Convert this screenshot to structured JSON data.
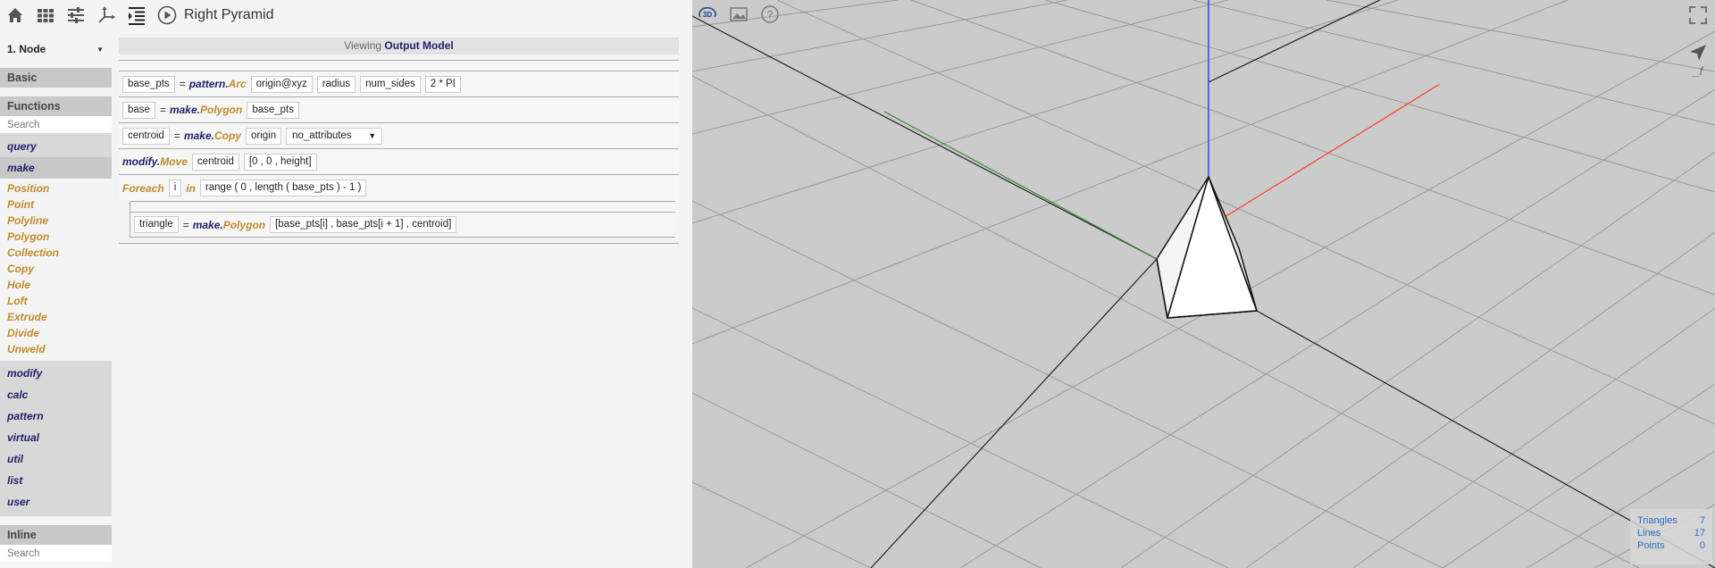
{
  "toolbar": {
    "icons": [
      "home-icon",
      "grid-icon",
      "sliders-icon",
      "axes-icon",
      "indent-icon",
      "play-icon"
    ],
    "title": "Right Pyramid"
  },
  "sidebar": {
    "node_select": "1. Node",
    "basic_label": "Basic",
    "functions_label": "Functions",
    "search_placeholder": "Search",
    "categories_top": [
      "query",
      "make"
    ],
    "make_functions": [
      "Position",
      "Point",
      "Polyline",
      "Polygon",
      "Collection",
      "Copy",
      "Hole",
      "Loft",
      "Extrude",
      "Divide",
      "Unweld"
    ],
    "categories_bottom": [
      "modify",
      "calc",
      "pattern",
      "virtual",
      "util",
      "list",
      "user"
    ],
    "inline_label": "Inline",
    "inline_search_placeholder": "Search"
  },
  "editor": {
    "viewing_prefix": "Viewing",
    "viewing_model": "Output Model",
    "lines": {
      "l1": {
        "var": "base_pts",
        "eq": "=",
        "module": "pattern.",
        "fn": "Arc",
        "args": [
          "origin@xyz",
          "radius",
          "num_sides",
          "2 * PI"
        ]
      },
      "l2": {
        "var": "base",
        "eq": "=",
        "module": "make.",
        "fn": "Polygon",
        "args": [
          "base_pts"
        ]
      },
      "l3": {
        "var": "centroid",
        "eq": "=",
        "module": "make.",
        "fn": "Copy",
        "args": [
          "origin"
        ],
        "dropdown": "no_attributes"
      },
      "l4": {
        "module": "modify.",
        "fn": "Move",
        "args": [
          "centroid",
          "[0 , 0 , height]"
        ]
      },
      "l5": {
        "keyword": "Foreach",
        "item": "i",
        "in": "in",
        "range": "range ( 0 , length ( base_pts ) - 1 )"
      },
      "l6": {
        "var": "triangle",
        "eq": "=",
        "module": "make.",
        "fn": "Polygon",
        "args": [
          "[base_pts[i] , base_pts[i + 1] , centroid]"
        ]
      }
    }
  },
  "viewer": {
    "icons": [
      "3d-view-icon",
      "image-icon",
      "help-icon",
      "fullscreen-icon",
      "send-icon",
      "function-icon"
    ],
    "view_label": "3D",
    "fx_label": "_f",
    "stats": {
      "triangles_label": "Triangles",
      "triangles": "7",
      "lines_label": "Lines",
      "lines": "17",
      "points_label": "Points",
      "points": "0"
    },
    "colors": {
      "background": "#cbcbcb",
      "grid": "#9a9a9a",
      "x_axis": "#ff3b1f",
      "y_axis": "#2f8f2f",
      "z_axis": "#1f3fff"
    }
  }
}
